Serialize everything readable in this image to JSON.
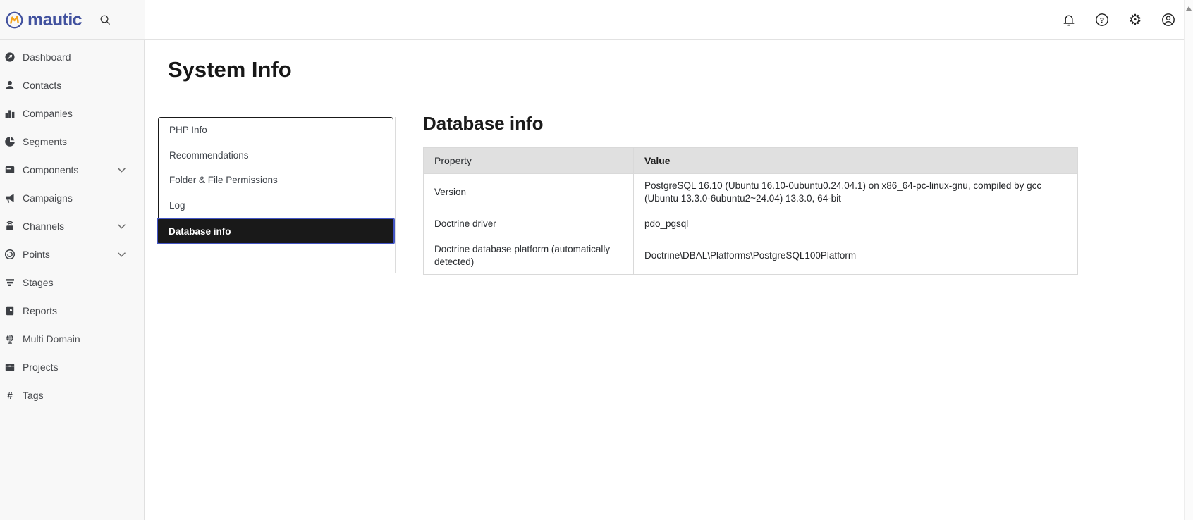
{
  "topbar": {
    "brand": "mautic",
    "right_icons": [
      {
        "name": "notifications",
        "icon": "bell-icon"
      },
      {
        "name": "help",
        "icon": "help-icon"
      },
      {
        "name": "settings",
        "icon": "gear-icon"
      },
      {
        "name": "account",
        "icon": "account-icon"
      }
    ]
  },
  "sidebar": {
    "items": [
      {
        "label": "Dashboard",
        "icon": "dashboard-icon",
        "has_submenu": false
      },
      {
        "label": "Contacts",
        "icon": "contacts-icon",
        "has_submenu": false
      },
      {
        "label": "Companies",
        "icon": "companies-icon",
        "has_submenu": false
      },
      {
        "label": "Segments",
        "icon": "segments-icon",
        "has_submenu": false
      },
      {
        "label": "Components",
        "icon": "components-icon",
        "has_submenu": true
      },
      {
        "label": "Campaigns",
        "icon": "campaigns-icon",
        "has_submenu": false
      },
      {
        "label": "Channels",
        "icon": "channels-icon",
        "has_submenu": true
      },
      {
        "label": "Points",
        "icon": "points-icon",
        "has_submenu": true
      },
      {
        "label": "Stages",
        "icon": "stages-icon",
        "has_submenu": false
      },
      {
        "label": "Reports",
        "icon": "reports-icon",
        "has_submenu": false
      },
      {
        "label": "Multi Domain",
        "icon": "multi-domain-icon",
        "has_submenu": false
      },
      {
        "label": "Projects",
        "icon": "projects-icon",
        "has_submenu": false
      },
      {
        "label": "Tags",
        "icon": "tags-icon",
        "has_submenu": false
      }
    ]
  },
  "page": {
    "title": "System Info"
  },
  "tablist": {
    "items": [
      {
        "label": "PHP Info",
        "active": false
      },
      {
        "label": "Recommendations",
        "active": false
      },
      {
        "label": "Folder & File Permissions",
        "active": false
      },
      {
        "label": "Log",
        "active": false
      },
      {
        "label": "Database info",
        "active": true
      }
    ]
  },
  "panel": {
    "title": "Database info",
    "table": {
      "headers": [
        "Property",
        "Value"
      ],
      "rows": [
        {
          "property": "Version",
          "value": "PostgreSQL 16.10 (Ubuntu 16.10-0ubuntu0.24.04.1) on x86_64-pc-linux-gnu, compiled by gcc (Ubuntu 13.3.0-6ubuntu2~24.04) 13.3.0, 64-bit"
        },
        {
          "property": "Doctrine driver",
          "value": "pdo_pgsql"
        },
        {
          "property": "Doctrine database platform (automatically detected)",
          "value": "Doctrine\\DBAL\\Platforms\\PostgreSQL100Platform"
        }
      ]
    }
  },
  "colors": {
    "brand_blue": "#41519e",
    "brand_yellow": "#f5a31b",
    "active_tab_bg": "#191919",
    "active_tab_border": "#4355c4",
    "table_header_bg": "#e0e0e0",
    "sidebar_bg": "#f8f8f8"
  }
}
